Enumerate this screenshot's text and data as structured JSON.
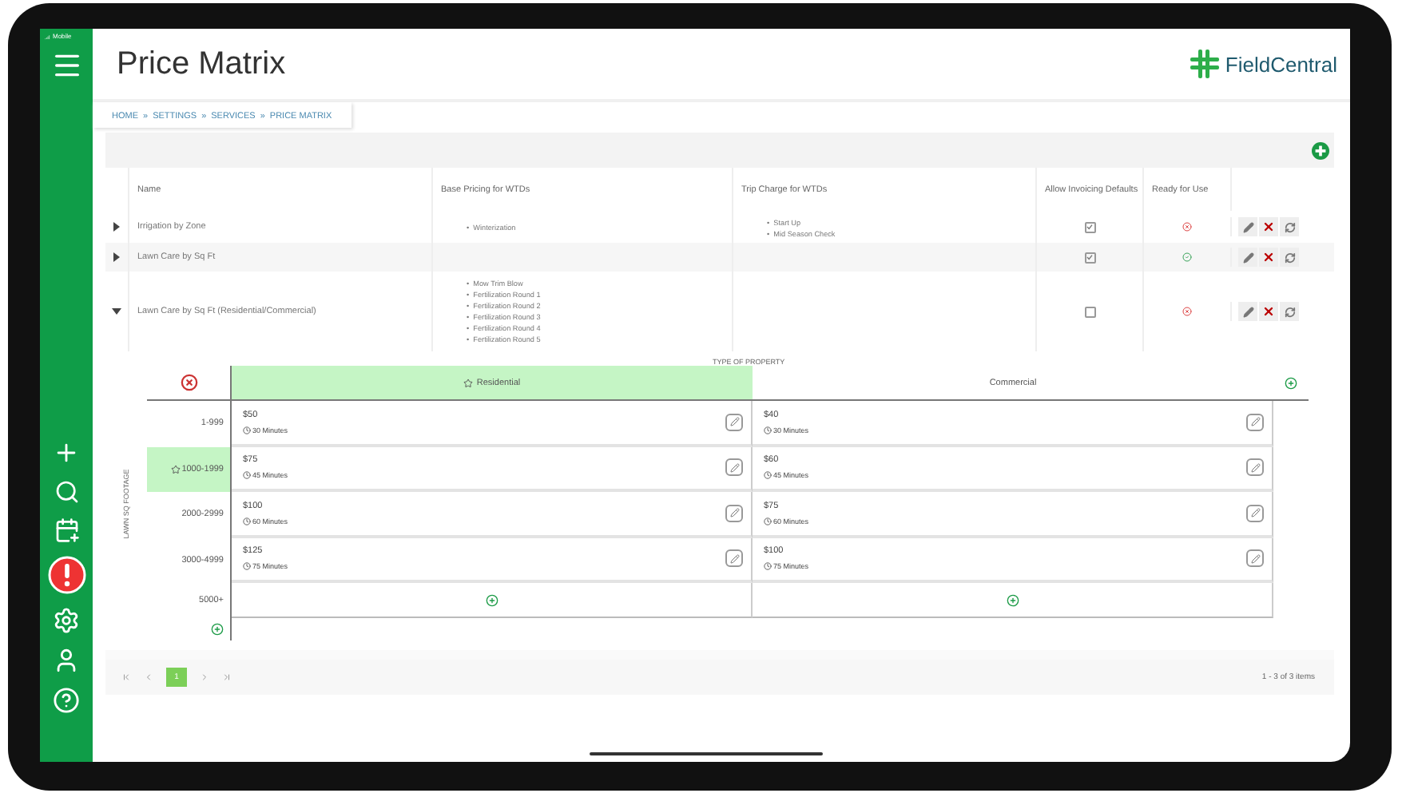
{
  "status_bar": {
    "carrier": "Mobile"
  },
  "page": {
    "title": "Price Matrix",
    "logo": "FieldCentral"
  },
  "breadcrumb": [
    "HOME",
    "SETTINGS",
    "SERVICES",
    "PRICE MATRIX"
  ],
  "breadcrumb_separator": "»",
  "table": {
    "bullet": "•",
    "columns": [
      "Name",
      "Base Pricing for WTDs",
      "Trip Charge for WTDs",
      "Allow Invoicing Defaults",
      "Ready for Use"
    ],
    "rows": [
      {
        "name": "Irrigation by Zone",
        "expanded": false,
        "base_pricing": [
          "Winterization"
        ],
        "trip_charge": [
          "Start Up",
          "Mid Season Check"
        ],
        "invoicing": true,
        "ready": false
      },
      {
        "name": "Lawn Care by Sq Ft",
        "expanded": false,
        "base_pricing": [],
        "trip_charge": [],
        "invoicing": true,
        "ready": true
      },
      {
        "name": "Lawn Care by Sq Ft (Residential/Commercial)",
        "expanded": true,
        "base_pricing": [
          "Mow Trim Blow",
          "Fertilization Round 1",
          "Fertilization Round 2",
          "Fertilization Round 3",
          "Fertilization Round 4",
          "Fertilization Round 5"
        ],
        "trip_charge": [],
        "invoicing": false,
        "ready": false
      }
    ]
  },
  "matrix": {
    "column_axis": "TYPE OF PROPERTY",
    "row_axis": "LAWN SQ FOOTAGE",
    "columns": [
      {
        "label": "Residential",
        "selected": true
      },
      {
        "label": "Commercial",
        "selected": false
      }
    ],
    "rows": [
      {
        "label": "1-999",
        "selected": false,
        "cells": [
          {
            "price": "$50",
            "duration": "30 Minutes"
          },
          {
            "price": "$40",
            "duration": "30 Minutes"
          }
        ]
      },
      {
        "label": "1000-1999",
        "selected": true,
        "cells": [
          {
            "price": "$75",
            "duration": "45 Minutes"
          },
          {
            "price": "$60",
            "duration": "45 Minutes"
          }
        ]
      },
      {
        "label": "2000-2999",
        "selected": false,
        "cells": [
          {
            "price": "$100",
            "duration": "60 Minutes"
          },
          {
            "price": "$75",
            "duration": "60 Minutes"
          }
        ]
      },
      {
        "label": "3000-4999",
        "selected": false,
        "cells": [
          {
            "price": "$125",
            "duration": "75 Minutes"
          },
          {
            "price": "$100",
            "duration": "75 Minutes"
          }
        ]
      },
      {
        "label": "5000+",
        "selected": false,
        "cells": []
      }
    ]
  },
  "pager": {
    "pages": [
      {
        "label": "1",
        "selected": true
      }
    ],
    "summary": "1 - 3 of 3 items"
  }
}
